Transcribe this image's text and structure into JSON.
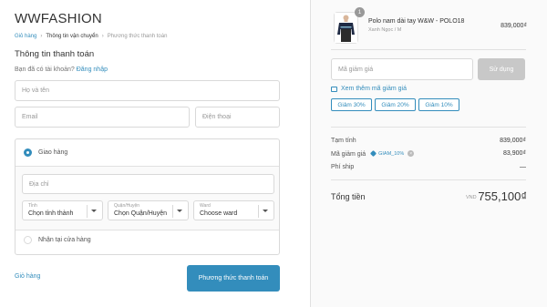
{
  "brand": "WWFASHION",
  "breadcrumb": [
    "Giỏ hàng",
    "Thông tin vận chuyển",
    "Phương thức thanh toán"
  ],
  "section_title": "Thông tin thanh toán",
  "login_prompt": "Bạn đã có tài khoản?",
  "login_link": "Đăng nhập",
  "form": {
    "name_placeholder": "Họ và tên",
    "email_placeholder": "Email",
    "phone_placeholder": "Điện thoại",
    "delivery_option": "Giao hàng",
    "address_placeholder": "Địa chỉ",
    "province_label": "Tỉnh",
    "province_value": "Chọn tỉnh thành",
    "district_label": "Quận/Huyện",
    "district_value": "Chọn Quận/Huyện",
    "ward_label": "Ward",
    "ward_value": "Choose ward",
    "pickup_option": "Nhận tại cửa hàng"
  },
  "footer": {
    "back_label": "Giỏ hàng",
    "continue_label": "Phương thức thanh toán"
  },
  "cart": {
    "quantity": "1",
    "product_name": "Polo nam dài tay W&W - POLO18",
    "variant": "Xanh Ngọc / M",
    "price": "839,000₫"
  },
  "coupon": {
    "placeholder": "Mã giảm giá",
    "apply_label": "Sử dụng",
    "more_label": "Xem thêm mã giảm giá",
    "chips": [
      "Giảm 30%",
      "Giảm 20%",
      "Giảm 10%"
    ]
  },
  "summary": {
    "subtotal_label": "Tạm tính",
    "subtotal_value": "839,000₫",
    "discount_label": "Mã giảm giá",
    "discount_code": "GIAM_10%",
    "discount_value": "83,900₫",
    "shipping_label": "Phí ship",
    "shipping_value": "—",
    "total_label": "Tổng tiền",
    "currency": "VND",
    "total_value": "755,100₫"
  },
  "colors": {
    "accent": "#338dbc",
    "disabled_button": "#c8c8c8",
    "border": "#d9d9d9"
  }
}
